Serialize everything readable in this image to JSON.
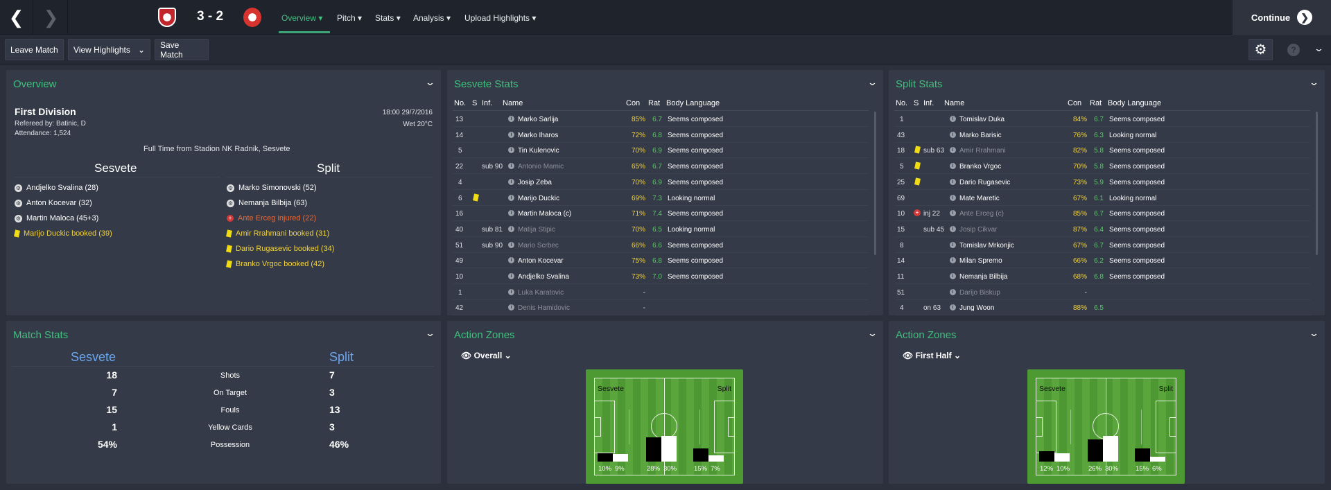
{
  "topbar": {
    "back": "❮",
    "forward": "❯",
    "score": "3 - 2",
    "menu": [
      "Overview",
      "Pitch",
      "Stats",
      "Analysis",
      "Upload Highlights"
    ],
    "continue": "Continue"
  },
  "toolbar": {
    "leave": "Leave Match",
    "highlights": "View Highlights",
    "save": "Save Match"
  },
  "overview": {
    "title": "Overview",
    "competition": "First Division",
    "referee": "Refereed by: Batinic, D",
    "attendance": "Attendance: 1,524",
    "datetime": "18:00 29/7/2016",
    "weather": "Wet 20°C",
    "summary": "Full Time from Stadion NK Radnik, Sesvete",
    "home": "Sesvete",
    "away": "Split",
    "home_events": [
      {
        "icon": "goal",
        "text": "Andjelko Svalina (28)",
        "color": "#ffffff"
      },
      {
        "icon": "goal",
        "text": "Anton Kocevar (32)",
        "color": "#ffffff"
      },
      {
        "icon": "goal",
        "text": "Martin Maloca (45+3)",
        "color": "#ffffff"
      },
      {
        "icon": "yellow",
        "text": "Marijo Duckic booked (39)",
        "color": "#f2d33b"
      }
    ],
    "away_events": [
      {
        "icon": "goal",
        "text": "Marko Simonovski (52)",
        "color": "#ffffff"
      },
      {
        "icon": "goal",
        "text": "Nemanja Bilbija (63)",
        "color": "#ffffff"
      },
      {
        "icon": "injury",
        "text": "Ante Erceg injured (22)",
        "color": "#e8693a"
      },
      {
        "icon": "yellow",
        "text": "Amir Rrahmani booked (31)",
        "color": "#f2d33b"
      },
      {
        "icon": "yellow",
        "text": "Dario Rugasevic booked (34)",
        "color": "#f2d33b"
      },
      {
        "icon": "yellow",
        "text": "Branko Vrgoc booked (42)",
        "color": "#f2d33b"
      }
    ]
  },
  "headers": {
    "no": "No.",
    "s": "S",
    "inf": "Inf.",
    "name": "Name",
    "con": "Con",
    "rat": "Rat",
    "body": "Body Language"
  },
  "sesvete_stats": {
    "title": "Sesvete Stats",
    "rows": [
      {
        "no": "13",
        "s": "",
        "inf": "",
        "name": "Marko Sarlija",
        "con": "85%",
        "rat": "6.7",
        "body": "Seems composed",
        "dim": false
      },
      {
        "no": "14",
        "s": "",
        "inf": "",
        "name": "Marko Iharos",
        "con": "72%",
        "rat": "6.8",
        "body": "Seems composed",
        "dim": false
      },
      {
        "no": "5",
        "s": "",
        "inf": "",
        "name": "Tin Kulenovic",
        "con": "70%",
        "rat": "6.9",
        "body": "Seems composed",
        "dim": false
      },
      {
        "no": "22",
        "s": "",
        "inf": "sub 90",
        "name": "Antonio Mamic",
        "con": "65%",
        "rat": "6.7",
        "body": "Seems composed",
        "dim": true
      },
      {
        "no": "4",
        "s": "",
        "inf": "",
        "name": "Josip Zeba",
        "con": "70%",
        "rat": "6.9",
        "body": "Seems composed",
        "dim": false
      },
      {
        "no": "6",
        "s": "yellow",
        "inf": "",
        "name": "Marijo Duckic",
        "con": "69%",
        "rat": "7.3",
        "body": "Looking normal",
        "dim": false
      },
      {
        "no": "16",
        "s": "",
        "inf": "",
        "name": "Martin Maloca (c)",
        "con": "71%",
        "rat": "7.4",
        "body": "Seems composed",
        "dim": false
      },
      {
        "no": "40",
        "s": "",
        "inf": "sub 81",
        "name": "Matija Stipic",
        "con": "70%",
        "rat": "6.5",
        "body": "Looking normal",
        "dim": true
      },
      {
        "no": "51",
        "s": "",
        "inf": "sub 90",
        "name": "Mario Scrbec",
        "con": "66%",
        "rat": "6.6",
        "body": "Seems composed",
        "dim": true
      },
      {
        "no": "49",
        "s": "",
        "inf": "",
        "name": "Anton Kocevar",
        "con": "75%",
        "rat": "6.8",
        "body": "Seems composed",
        "dim": false
      },
      {
        "no": "10",
        "s": "",
        "inf": "",
        "name": "Andjelko Svalina",
        "con": "73%",
        "rat": "7.0",
        "body": "Seems composed",
        "dim": false
      },
      {
        "no": "1",
        "s": "",
        "inf": "",
        "name": "Luka Karatovic",
        "con": "-",
        "rat": "",
        "body": "",
        "dim": true
      },
      {
        "no": "42",
        "s": "",
        "inf": "",
        "name": "Denis Hamidovic",
        "con": "-",
        "rat": "",
        "body": "",
        "dim": true
      }
    ]
  },
  "split_stats": {
    "title": "Split Stats",
    "rows": [
      {
        "no": "1",
        "s": "",
        "inf": "",
        "name": "Tomislav Duka",
        "con": "84%",
        "rat": "6.7",
        "body": "Seems composed",
        "dim": false
      },
      {
        "no": "43",
        "s": "",
        "inf": "",
        "name": "Marko Barisic",
        "con": "76%",
        "rat": "6.3",
        "body": "Looking normal",
        "dim": false
      },
      {
        "no": "18",
        "s": "yellow",
        "inf": "sub 63",
        "name": "Amir Rrahmani",
        "con": "82%",
        "rat": "5.8",
        "body": "Seems composed",
        "dim": true
      },
      {
        "no": "5",
        "s": "yellow",
        "inf": "",
        "name": "Branko Vrgoc",
        "con": "70%",
        "rat": "5.8",
        "body": "Seems composed",
        "dim": false
      },
      {
        "no": "25",
        "s": "yellow",
        "inf": "",
        "name": "Dario Rugasevic",
        "con": "73%",
        "rat": "5.9",
        "body": "Seems composed",
        "dim": false
      },
      {
        "no": "69",
        "s": "",
        "inf": "",
        "name": "Mate Maretic",
        "con": "67%",
        "rat": "6.1",
        "body": "Looking normal",
        "dim": false
      },
      {
        "no": "10",
        "s": "injury",
        "inf": "inj 22",
        "name": "Ante Erceg (c)",
        "con": "85%",
        "rat": "6.7",
        "body": "Seems composed",
        "dim": true
      },
      {
        "no": "15",
        "s": "",
        "inf": "sub 45",
        "name": "Josip Cikvar",
        "con": "87%",
        "rat": "6.4",
        "body": "Seems composed",
        "dim": true
      },
      {
        "no": "8",
        "s": "",
        "inf": "",
        "name": "Tomislav Mrkonjic",
        "con": "67%",
        "rat": "6.7",
        "body": "Seems composed",
        "dim": false
      },
      {
        "no": "14",
        "s": "",
        "inf": "",
        "name": "Milan Spremo",
        "con": "66%",
        "rat": "6.2",
        "body": "Seems composed",
        "dim": false
      },
      {
        "no": "11",
        "s": "",
        "inf": "",
        "name": "Nemanja Bilbija",
        "con": "68%",
        "rat": "6.8",
        "body": "Seems composed",
        "dim": false
      },
      {
        "no": "51",
        "s": "",
        "inf": "",
        "name": "Darijo Biskup",
        "con": "-",
        "rat": "",
        "body": "",
        "dim": true
      },
      {
        "no": "4",
        "s": "",
        "inf": "on 63",
        "name": "Jung Woon",
        "con": "88%",
        "rat": "6.5",
        "body": "",
        "dim": false
      }
    ]
  },
  "match_stats": {
    "title": "Match Stats",
    "home": "Sesvete",
    "away": "Split",
    "rows": [
      {
        "label": "Shots",
        "home": "18",
        "away": "7"
      },
      {
        "label": "On Target",
        "home": "7",
        "away": "3"
      },
      {
        "label": "Fouls",
        "home": "15",
        "away": "13"
      },
      {
        "label": "Yellow Cards",
        "home": "1",
        "away": "3"
      },
      {
        "label": "Possession",
        "home": "54%",
        "away": "46%"
      }
    ]
  },
  "zones": [
    {
      "title": "Action Zones",
      "filter": "Overall",
      "home": "Sesvete",
      "away": "Split",
      "pct": [
        "10%",
        "9%",
        "28%",
        "30%",
        "15%",
        "7%"
      ],
      "values": [
        10,
        9,
        28,
        30,
        15,
        7
      ]
    },
    {
      "title": "Action Zones",
      "filter": "First Half",
      "home": "Sesvete",
      "away": "Split",
      "pct": [
        "12%",
        "10%",
        "26%",
        "30%",
        "15%",
        "6%"
      ],
      "values": [
        12,
        10,
        26,
        30,
        15,
        6
      ]
    }
  ],
  "colors": {
    "accent": "#3ec07e",
    "yellow": "#f2d33b",
    "rating": "#5cc76a",
    "stats_team": "#6aa7f0"
  }
}
